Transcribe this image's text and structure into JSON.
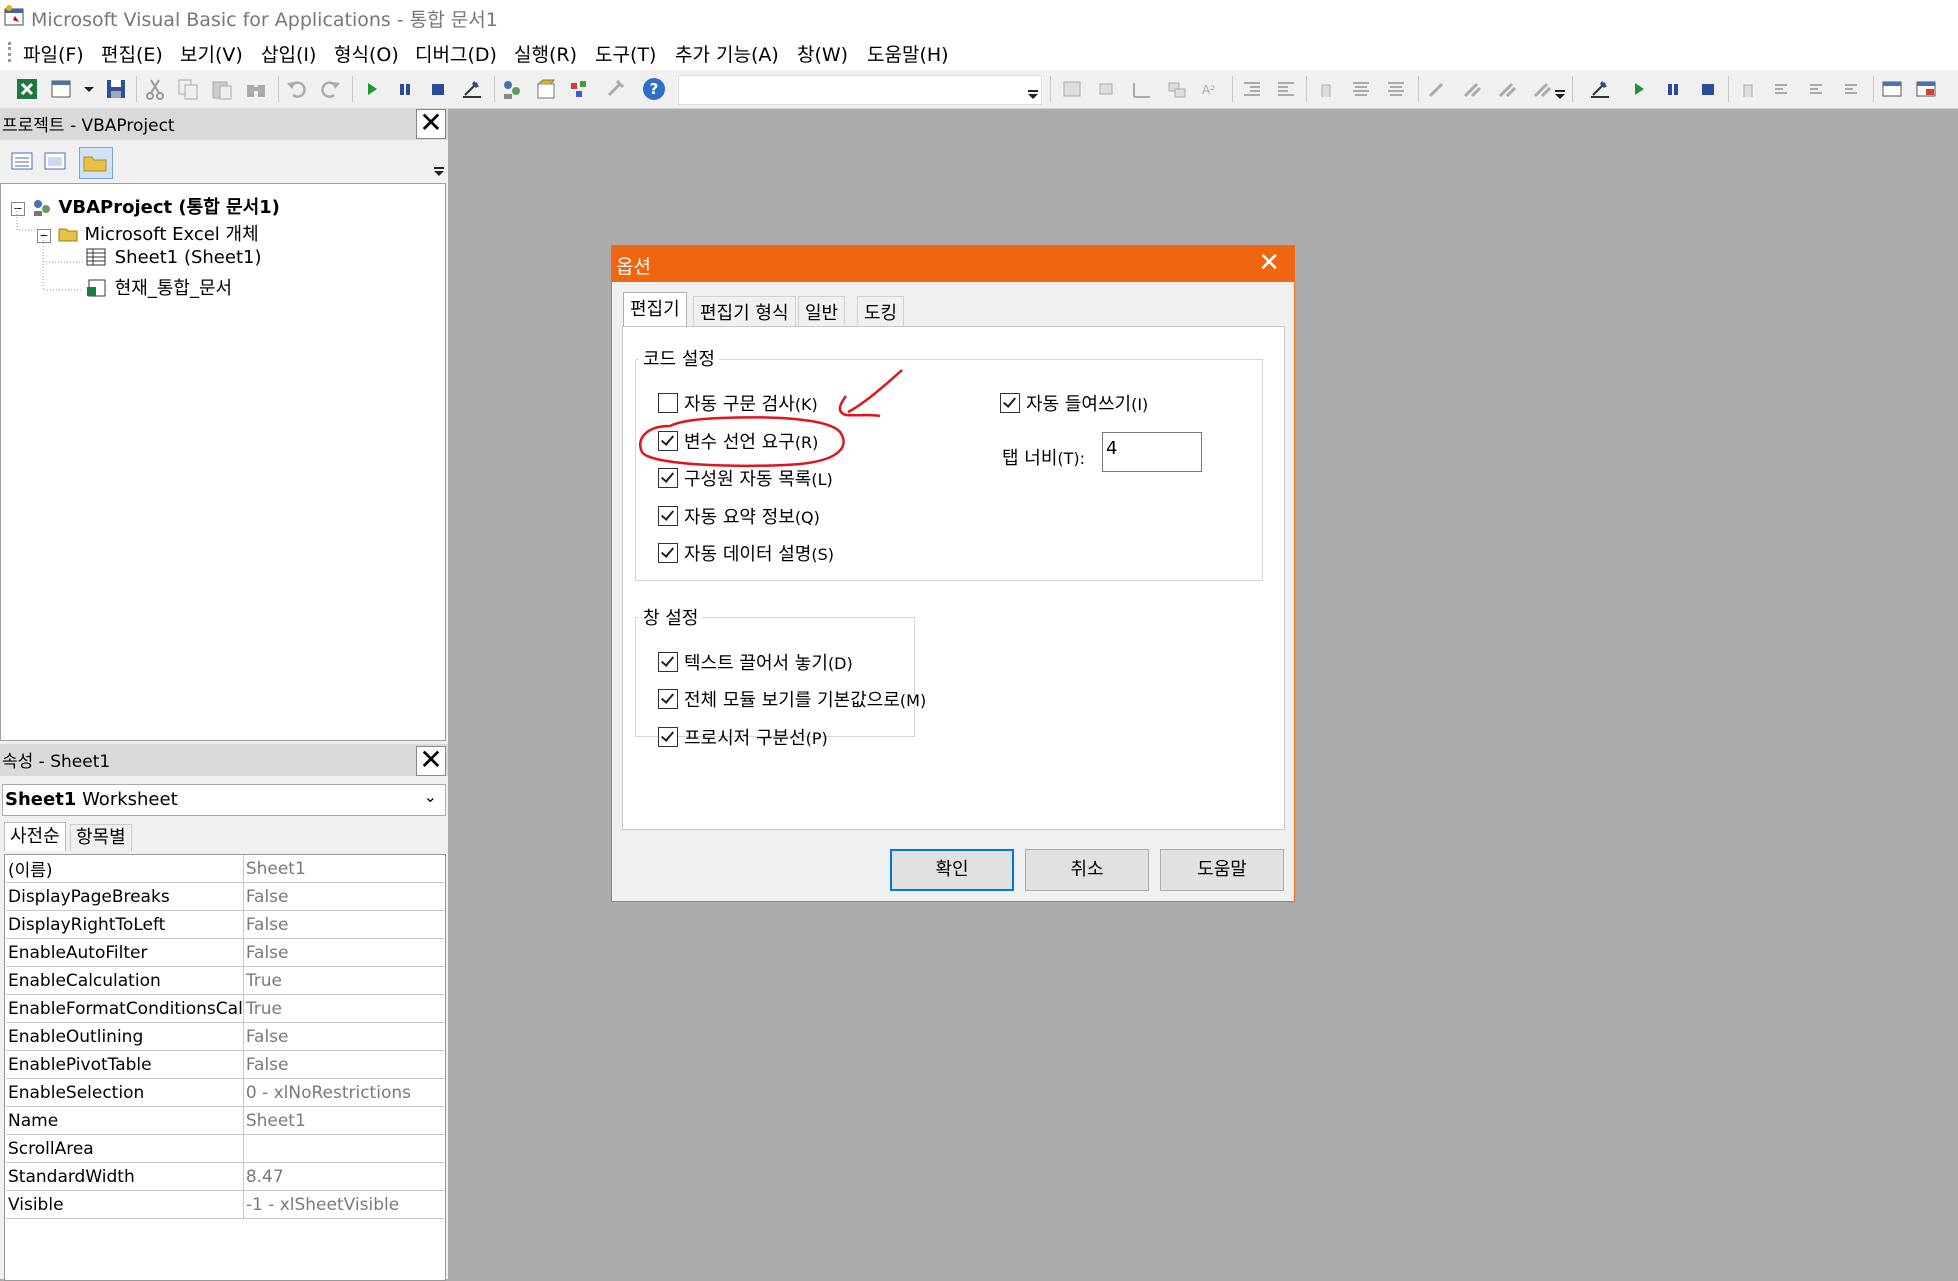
{
  "window": {
    "title": "Microsoft Visual Basic for Applications - 통합 문서1"
  },
  "menu": [
    "파일(F)",
    "편집(E)",
    "보기(V)",
    "삽입(I)",
    "형식(O)",
    "디버그(D)",
    "실행(R)",
    "도구(T)",
    "추가 기능(A)",
    "창(W)",
    "도움말(H)"
  ],
  "toolbar": {
    "icons": [
      "excel-icon",
      "insert-userform-icon",
      "save-icon",
      "cut-icon",
      "copy-icon",
      "paste-icon",
      "find-icon",
      "undo-icon",
      "redo-icon",
      "run-icon",
      "break-icon",
      "reset-icon",
      "design-mode-icon",
      "project-explorer-icon",
      "properties-icon",
      "object-browser-icon",
      "toolbox-icon",
      "help-icon"
    ],
    "right_icons": [
      "list-properties-icon",
      "list-constants-icon",
      "quick-info-icon",
      "parameter-info-icon",
      "complete-word-icon",
      "indent-icon",
      "outdent-icon",
      "toggle-breakpoint-icon",
      "comment-block-icon",
      "uncomment-block-icon",
      "toggle-bookmark-icon",
      "next-bookmark-icon",
      "previous-bookmark-icon",
      "clear-bookmarks-icon",
      "design-mode-icon",
      "run-icon",
      "break-icon",
      "reset-icon",
      "toggle-breakpoint-icon",
      "step-into-icon",
      "step-over-icon",
      "step-out-icon",
      "locals-window-icon",
      "immediate-window-icon",
      "watch-window-icon"
    ]
  },
  "project_panel": {
    "title": "프로젝트 - VBAProject",
    "tree": {
      "root": "VBAProject (통합 문서1)",
      "folder": "Microsoft Excel 개체",
      "items": [
        "Sheet1 (Sheet1)",
        "현재_통합_문서"
      ]
    }
  },
  "props_panel": {
    "title": "속성 - Sheet1",
    "object_bold": "Sheet1",
    "object_type": "Worksheet",
    "tabs": [
      "사전순",
      "항목별"
    ],
    "rows": [
      {
        "key": "(이름)",
        "value": "Sheet1"
      },
      {
        "key": "DisplayPageBreaks",
        "value": "False"
      },
      {
        "key": "DisplayRightToLeft",
        "value": "False"
      },
      {
        "key": "EnableAutoFilter",
        "value": "False"
      },
      {
        "key": "EnableCalculation",
        "value": "True"
      },
      {
        "key": "EnableFormatConditionsCal",
        "value": "True"
      },
      {
        "key": "EnableOutlining",
        "value": "False"
      },
      {
        "key": "EnablePivotTable",
        "value": "False"
      },
      {
        "key": "EnableSelection",
        "value": "0 - xlNoRestrictions"
      },
      {
        "key": "Name",
        "value": "Sheet1"
      },
      {
        "key": "ScrollArea",
        "value": ""
      },
      {
        "key": "StandardWidth",
        "value": "8.47"
      },
      {
        "key": "Visible",
        "value": "-1 - xlSheetVisible"
      }
    ]
  },
  "dialog": {
    "title": "옵션",
    "close": "✕",
    "tabs": [
      "편집기",
      "편집기 형식",
      "일반",
      "도킹"
    ],
    "code_group": {
      "label": "코드 설정",
      "checks": [
        {
          "label": "자동 구문 검사",
          "key": "(K)",
          "checked": false
        },
        {
          "label": "변수 선언 요구",
          "key": "(R)",
          "checked": true
        },
        {
          "label": "구성원 자동 목록",
          "key": "(L)",
          "checked": true
        },
        {
          "label": "자동 요약 정보",
          "key": "(Q)",
          "checked": true
        },
        {
          "label": "자동 데이터 설명",
          "key": "(S)",
          "checked": true
        }
      ],
      "auto_indent": {
        "label": "자동 들여쓰기",
        "key": "(I)",
        "checked": true
      },
      "tab_width": {
        "label": "탭 너비",
        "key": "(T):",
        "value": "4"
      }
    },
    "window_group": {
      "label": "창 설정",
      "checks": [
        {
          "label": "텍스트 끌어서 놓기",
          "key": "(D)",
          "checked": true
        },
        {
          "label": "전체 모듈 보기를 기본값으로",
          "key": "(M)",
          "checked": true
        },
        {
          "label": "프로시저 구분선",
          "key": "(P)",
          "checked": true
        }
      ]
    },
    "buttons": {
      "ok": "확인",
      "cancel": "취소",
      "help": "도움말"
    }
  },
  "annotation": {
    "color": "#e0141e"
  }
}
